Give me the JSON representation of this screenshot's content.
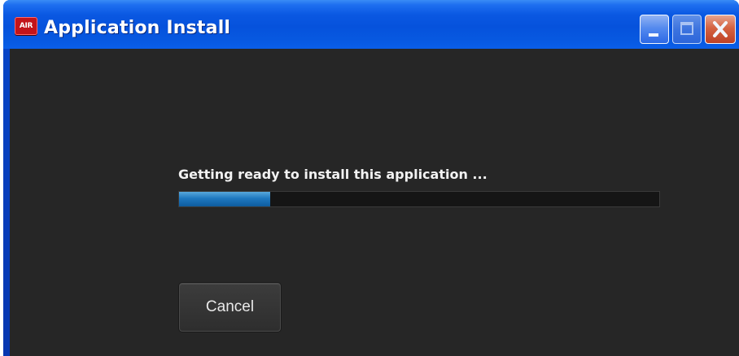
{
  "window": {
    "title": "Application Install",
    "app_icon_text": "AIR",
    "controls": {
      "minimize_icon": "minimize-icon",
      "maximize_icon": "maximize-icon",
      "close_icon": "close-icon"
    }
  },
  "install": {
    "status_text": "Getting ready to install this application ...",
    "progress": 0.19,
    "cancel_label": "Cancel"
  },
  "colors": {
    "content_background": "#262626",
    "progress_fill": "#1e78c0",
    "titlebar": "#0a5ee8",
    "close_button": "#e0643a"
  }
}
